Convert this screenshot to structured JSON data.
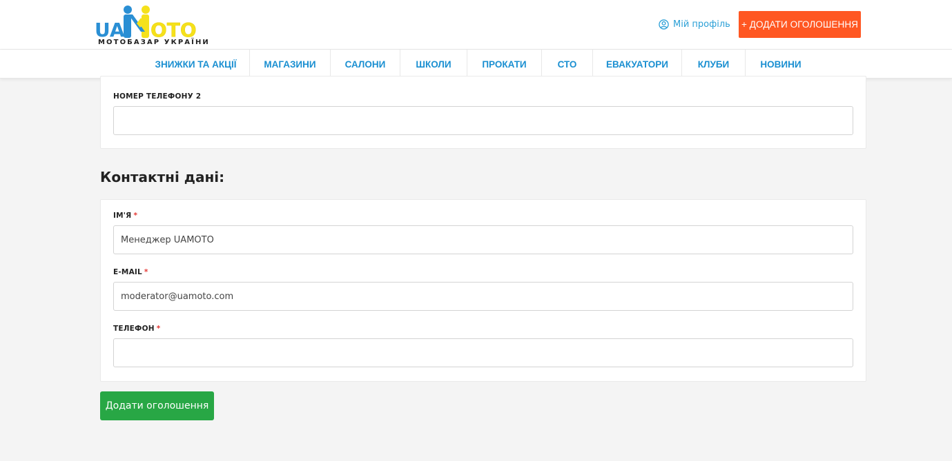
{
  "header": {
    "logo": {
      "part1": "UA",
      "part2": "MOTO",
      "tagline": "МОТОБАЗАР УКРАЇНИ"
    },
    "profile_label": "Мій профіль",
    "add_ad_label": "+ ДОДАТИ ОГОЛОШЕННЯ"
  },
  "nav": {
    "items": [
      {
        "label": "ЗНИЖКИ ТА АКЦІЇ"
      },
      {
        "label": "МАГАЗИНИ"
      },
      {
        "label": "САЛОНИ"
      },
      {
        "label": "ШКОЛИ"
      },
      {
        "label": "ПРОКАТИ"
      },
      {
        "label": "СТО"
      },
      {
        "label": "ЕВАКУАТОРИ"
      },
      {
        "label": "КЛУБИ"
      },
      {
        "label": "НОВИНИ"
      }
    ]
  },
  "phone_section": {
    "phone2_label": "НОМЕР ТЕЛЕФОНУ 2",
    "phone2_value": ""
  },
  "contacts": {
    "title": "Контактні дані:",
    "required_mark": "*",
    "name_label": "ІМ'Я",
    "name_value": "Менеджер UAMOTO",
    "email_label": "E-MAIL",
    "email_value": "moderator@uamoto.com",
    "phone_label": "ТЕЛЕФОН",
    "phone_value": ""
  },
  "submit_label": "Додати оголошення",
  "colors": {
    "accent_orange": "#ff5722",
    "link_blue": "#1a8fd1",
    "submit_green": "#28a745",
    "logo_blue": "#2a8fd4",
    "logo_yellow": "#f5e11b"
  }
}
